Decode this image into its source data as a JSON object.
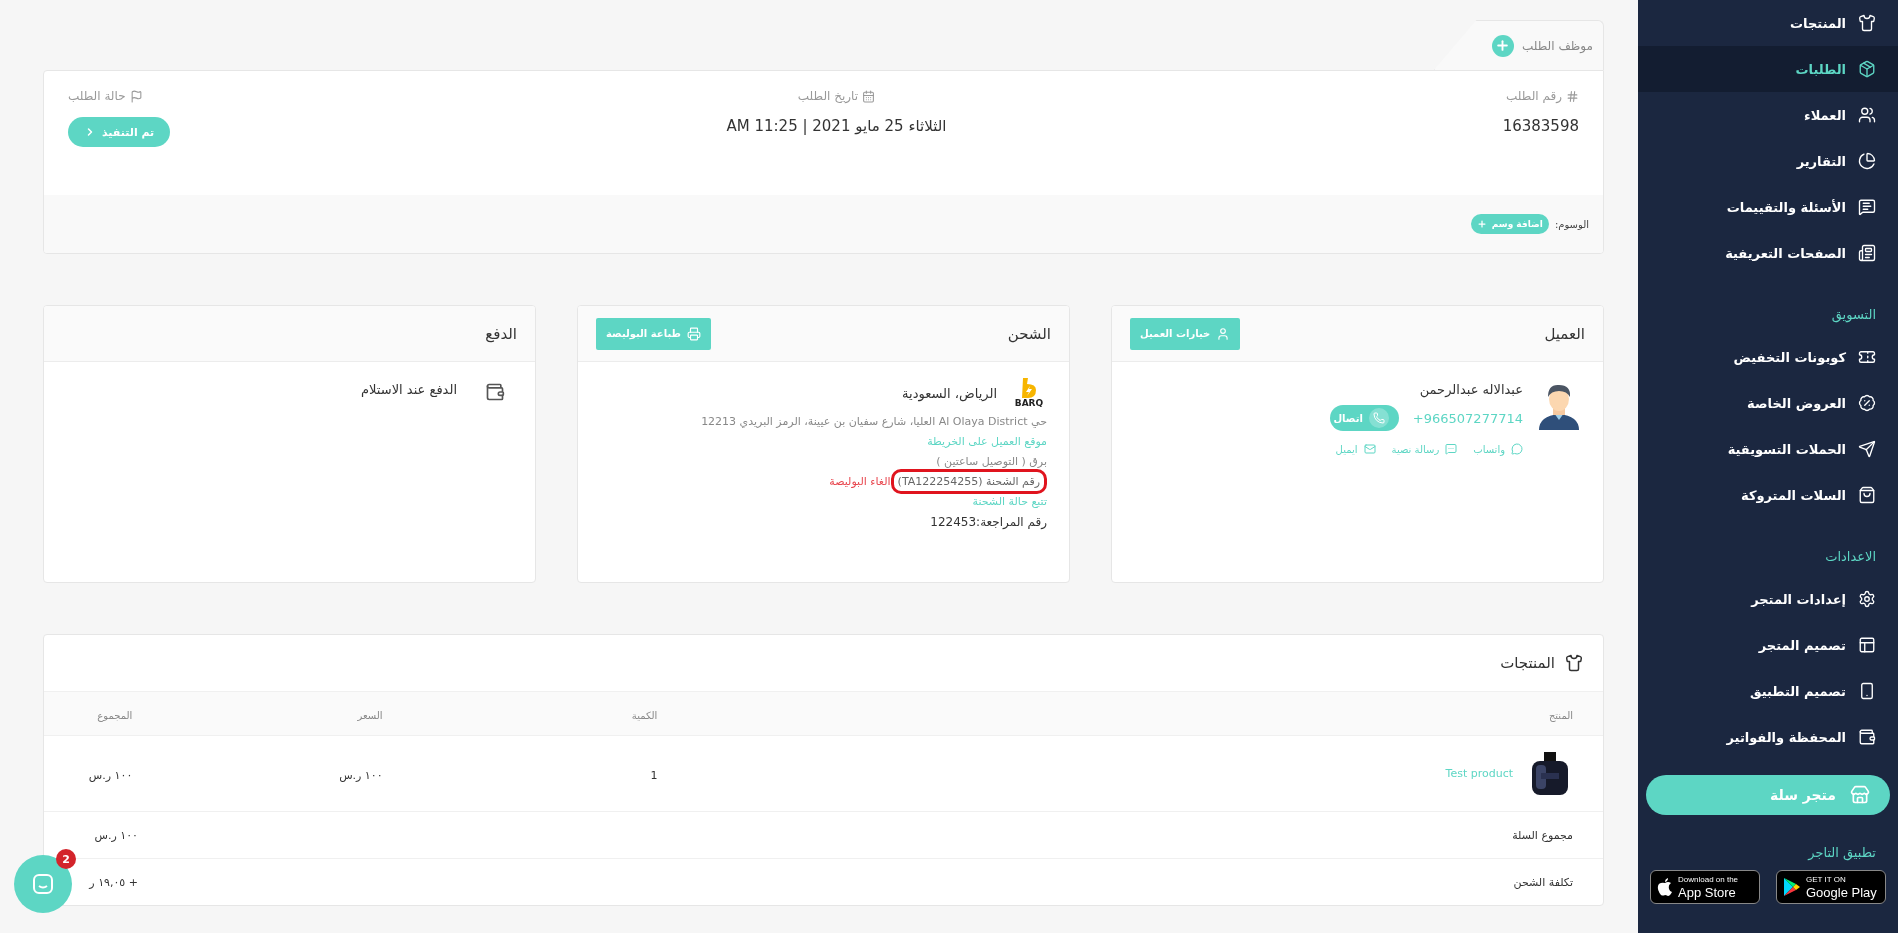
{
  "sidebar": {
    "groups": [
      {
        "items": [
          {
            "label": "المنتجات",
            "selected": false
          },
          {
            "label": "الطلبات",
            "selected": true
          },
          {
            "label": "العملاء",
            "selected": false
          },
          {
            "label": "التقارير",
            "selected": false
          },
          {
            "label": "الأسئلة والتقييمات",
            "selected": false
          },
          {
            "label": "الصفحات التعريفية",
            "selected": false
          }
        ]
      },
      {
        "title": "التسويق",
        "items": [
          {
            "label": "كوبونات التخفيض",
            "selected": false
          },
          {
            "label": "العروض الخاصة",
            "selected": false
          },
          {
            "label": "الحملات التسويقية",
            "selected": false
          },
          {
            "label": "السلات المتروكة",
            "selected": false
          }
        ]
      },
      {
        "title": "الاعدادات",
        "items": [
          {
            "label": "إعدادات المتجر",
            "selected": false
          },
          {
            "label": "تصميم المتجر",
            "selected": false
          },
          {
            "label": "تصميم التطبيق",
            "selected": false
          },
          {
            "label": "المحفظة والفواتير",
            "selected": false
          }
        ]
      }
    ],
    "store_button": "متجر سلة",
    "app_title": "تطبيق التاجر",
    "app_badges": [
      {
        "kind": "google",
        "small": "GET IT ON",
        "big": "Google Play"
      },
      {
        "kind": "apple",
        "small": "Download on the",
        "big": "App Store"
      }
    ]
  },
  "order": {
    "employee_tab": "موظف الطلب",
    "fields": [
      {
        "kind": "text",
        "label": "رقم الطلب",
        "value": "16383598"
      },
      {
        "kind": "text",
        "label": "تاريخ الطلب",
        "value": "الثلاثاء 25 مايو 2021 | 11:25 AM"
      },
      {
        "kind": "status",
        "label": "حالة الطلب",
        "value": "تم التنفيذ"
      }
    ],
    "tags_label": "الوسوم:",
    "add_tag": "اضافة وسم"
  },
  "customer": {
    "title": "العميل",
    "options_button": "خيارات العميل",
    "name": "عبدالاله عبدالرحمن",
    "phone": "+966507277714",
    "call_button": "اتصال",
    "contacts": [
      {
        "kind": "whatsapp",
        "label": "واتساب"
      },
      {
        "kind": "sms",
        "label": "رسالة نصية"
      },
      {
        "kind": "email",
        "label": "ايميل"
      }
    ]
  },
  "shipping": {
    "title": "الشحن",
    "print_button": "طباعة البوليصة",
    "carrier_logo": "BARQ",
    "city": "الرياض، السعودية",
    "address": "حي Al Olaya District العليا، شارع سفيان بن عيينة، الرمز البريدي 12213",
    "map_link": "موقع العميل على الخريطة",
    "method": "برق ( التوصيل ساعتين )",
    "shipment": {
      "text": "رقم الشحنة (TA122254255)",
      "highlighted": true
    },
    "cancel_link": "الغاء البوليصة",
    "track_link": "تتبع حالة الشحنة",
    "reference": "رقم المراجعة:122453"
  },
  "payment": {
    "title": "الدفع",
    "method": "الدفع عند الاستلام"
  },
  "products": {
    "title": "المنتجات",
    "columns": [
      "المنتج",
      "الكمية",
      "السعر",
      "المجموع"
    ],
    "rows": [
      {
        "kind": "picture",
        "name": "Test product",
        "quantity": "1",
        "price": "١٠٠ ر.س",
        "total": "١٠٠ ر.س"
      }
    ],
    "summary": [
      {
        "label": "مجموع السلة",
        "value": "١٠٠ ر.س"
      },
      {
        "label": "تكلفة الشحن",
        "value": "+ ١٩,٠٥ ر"
      }
    ]
  },
  "chat": {
    "badge": "2"
  }
}
